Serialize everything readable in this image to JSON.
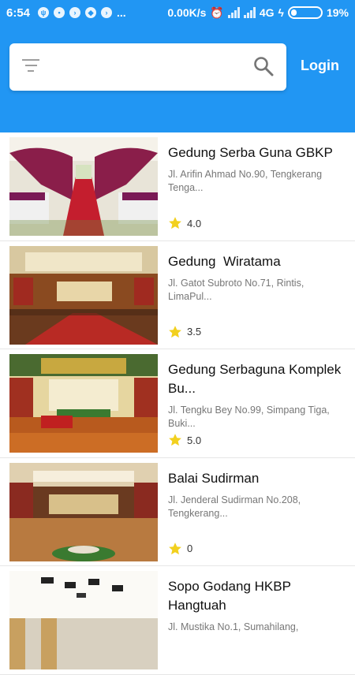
{
  "status": {
    "time": "6:54",
    "notif_more": "...",
    "speed": "0.00K/s",
    "network": "4G",
    "battery": "19%",
    "battery_level": 0.19
  },
  "search": {
    "placeholder": ""
  },
  "header": {
    "login_label": "Login"
  },
  "venues": [
    {
      "title": "Gedung Serba Guna GBKP",
      "address": "Jl. Arifin Ahmad No.90, Tengkerang Tenga...",
      "rating": "4.0"
    },
    {
      "title": "Gedung  Wiratama",
      "address": "Jl. Gatot Subroto No.71, Rintis, LimaPul...",
      "rating": "3.5"
    },
    {
      "title": "Gedung Serbaguna Komplek Bu...",
      "address": "Jl. Tengku Bey No.99, Simpang Tiga, Buki...",
      "rating": "5.0"
    },
    {
      "title": "Balai Sudirman",
      "address": "Jl. Jenderal Sudirman No.208, Tengkerang...",
      "rating": "0"
    },
    {
      "title": "Sopo Godang HKBP Hangtuah",
      "address": "Jl. Mustika No.1, Sumahilang,",
      "rating": ""
    }
  ],
  "colors": {
    "primary": "#2196F3",
    "star": "#F2D01E"
  }
}
